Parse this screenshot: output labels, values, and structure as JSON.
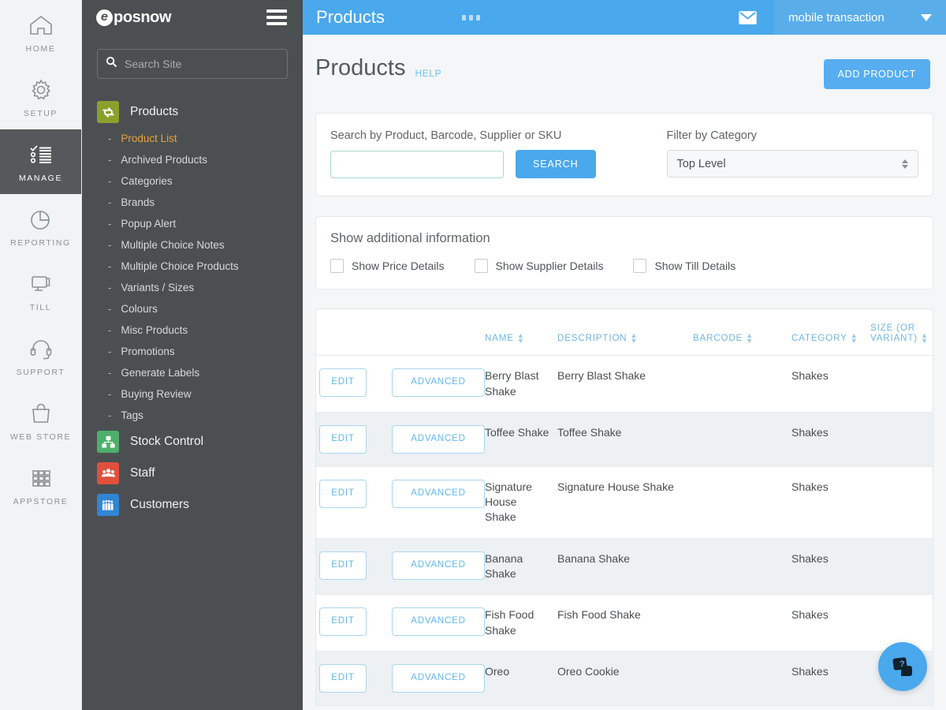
{
  "rail": {
    "items": [
      {
        "label": "HOME",
        "icon": "home-icon",
        "active": false
      },
      {
        "label": "SETUP",
        "icon": "gear-icon",
        "active": false
      },
      {
        "label": "MANAGE",
        "icon": "checklist-icon",
        "active": true
      },
      {
        "label": "REPORTING",
        "icon": "pie-chart-icon",
        "active": false
      },
      {
        "label": "TILL",
        "icon": "till-icon",
        "active": false
      },
      {
        "label": "SUPPORT",
        "icon": "headset-icon",
        "active": false
      },
      {
        "label": "WEB STORE",
        "icon": "shopping-bag-icon",
        "active": false
      },
      {
        "label": "APPSTORE",
        "icon": "grid-apps-icon",
        "active": false
      }
    ]
  },
  "sidebar": {
    "logo_mark": "e",
    "logo_text": "posnow",
    "search": {
      "placeholder": "Search Site",
      "value": ""
    },
    "sections": [
      {
        "label": "Products",
        "icon": "exchange-icon",
        "color": "#8aa02c",
        "items": [
          {
            "label": "Product List",
            "active": true
          },
          {
            "label": "Archived Products",
            "active": false
          },
          {
            "label": "Categories",
            "active": false
          },
          {
            "label": "Brands",
            "active": false
          },
          {
            "label": "Popup Alert",
            "active": false
          },
          {
            "label": "Multiple Choice Notes",
            "active": false
          },
          {
            "label": "Multiple Choice Products",
            "active": false
          },
          {
            "label": "Variants / Sizes",
            "active": false
          },
          {
            "label": "Colours",
            "active": false
          },
          {
            "label": "Misc Products",
            "active": false
          },
          {
            "label": "Promotions",
            "active": false
          },
          {
            "label": "Generate Labels",
            "active": false
          },
          {
            "label": "Buying Review",
            "active": false
          },
          {
            "label": "Tags",
            "active": false
          }
        ]
      },
      {
        "label": "Stock Control",
        "icon": "hierarchy-icon",
        "color": "#4cb06a",
        "items": []
      },
      {
        "label": "Staff",
        "icon": "people-icon",
        "color": "#e0503c",
        "items": []
      },
      {
        "label": "Customers",
        "icon": "customers-icon",
        "color": "#2f86d4",
        "items": []
      }
    ]
  },
  "topbar": {
    "title": "Products",
    "overflow_icon": "three-dots-icon",
    "mail_icon": "envelope-icon",
    "account": "mobile transaction",
    "accent": "#4aa8ec"
  },
  "page": {
    "title": "Products",
    "help": "HELP",
    "add_button": "ADD PRODUCT"
  },
  "search_panel": {
    "search_label": "Search by Product, Barcode, Supplier or SKU",
    "search_value": "",
    "search_placeholder": "",
    "search_button": "SEARCH",
    "category_label": "Filter by Category",
    "category_value": "Top Level"
  },
  "info_panel": {
    "title": "Show additional information",
    "checkboxes": [
      {
        "label": "Show Price Details",
        "checked": false
      },
      {
        "label": "Show Supplier Details",
        "checked": false
      },
      {
        "label": "Show Till Details",
        "checked": false
      }
    ]
  },
  "table": {
    "headers": [
      {
        "label": "",
        "sortable": false
      },
      {
        "label": "",
        "sortable": false
      },
      {
        "label": "NAME",
        "sortable": true
      },
      {
        "label": "DESCRIPTION",
        "sortable": true
      },
      {
        "label": "BARCODE",
        "sortable": true
      },
      {
        "label": "CATEGORY",
        "sortable": true
      },
      {
        "label": "SIZE (OR VARIANT)",
        "sortable": true
      }
    ],
    "edit_label": "EDIT",
    "advanced_label": "ADVANCED",
    "rows": [
      {
        "name": "Berry Blast Shake",
        "description": "Berry Blast Shake",
        "barcode": "",
        "category": "Shakes",
        "size": ""
      },
      {
        "name": "Toffee Shake",
        "description": "Toffee Shake",
        "barcode": "",
        "category": "Shakes",
        "size": ""
      },
      {
        "name": "Signature House Shake",
        "description": "Signature House Shake",
        "barcode": "",
        "category": "Shakes",
        "size": ""
      },
      {
        "name": "Banana Shake",
        "description": "Banana Shake",
        "barcode": "",
        "category": "Shakes",
        "size": ""
      },
      {
        "name": "Fish Food Shake",
        "description": "Fish Food Shake",
        "barcode": "",
        "category": "Shakes",
        "size": ""
      },
      {
        "name": "Oreo",
        "description": "Oreo Cookie",
        "barcode": "",
        "category": "Shakes",
        "size": ""
      }
    ]
  },
  "fab": {
    "icon": "help-chat-icon"
  }
}
